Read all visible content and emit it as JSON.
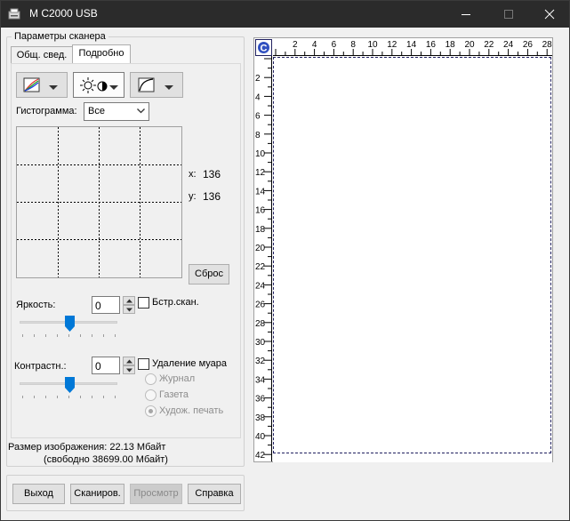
{
  "window": {
    "title": "M C2000 USB"
  },
  "group": {
    "title": "Параметры сканера"
  },
  "tabs": [
    {
      "label": "Общ. свед.",
      "active": false
    },
    {
      "label": "Подробно",
      "active": true
    }
  ],
  "histogram": {
    "label": "Гистограмма:",
    "channel": "Все",
    "x_label": "x:",
    "x_value": "136",
    "y_label": "y:",
    "y_value": "136",
    "reset_label": "Сброс"
  },
  "brightness": {
    "label": "Яркость:",
    "value": "0",
    "slider_level": 0.5,
    "checkbox_label": "Бстр.скан.",
    "checked": false
  },
  "contrast": {
    "label": "Контрастн.:",
    "value": "0",
    "slider_level": 0.5,
    "checkbox_label": "Удаление муара",
    "checked": false,
    "radios": [
      {
        "label": "Журнал",
        "selected": false
      },
      {
        "label": "Газета",
        "selected": false
      },
      {
        "label": "Худож. печать",
        "selected": true
      }
    ]
  },
  "image_size": {
    "text": "Размер изображения: 22.13 Мбайт",
    "free": "(свободно 38699.00 Мбайт)"
  },
  "buttons": {
    "exit": "Выход",
    "scan": "Сканиров.",
    "preview": "Просмотр",
    "help": "Справка"
  },
  "preview": {
    "top_ruler": [
      "2",
      "4",
      "6",
      "8",
      "10",
      "12",
      "14",
      "16",
      "18",
      "20",
      "22",
      "24",
      "26",
      "28"
    ],
    "left_ruler": [
      "2",
      "4",
      "6",
      "8",
      "10",
      "12",
      "14",
      "16",
      "18",
      "20",
      "22",
      "24",
      "26",
      "28",
      "30",
      "32",
      "34",
      "36",
      "38",
      "40",
      "42"
    ],
    "unit_button": "C"
  },
  "colors": {
    "titlebar": "#2b2b2b",
    "accent": "#0078d7",
    "scan_border": "#202060"
  }
}
